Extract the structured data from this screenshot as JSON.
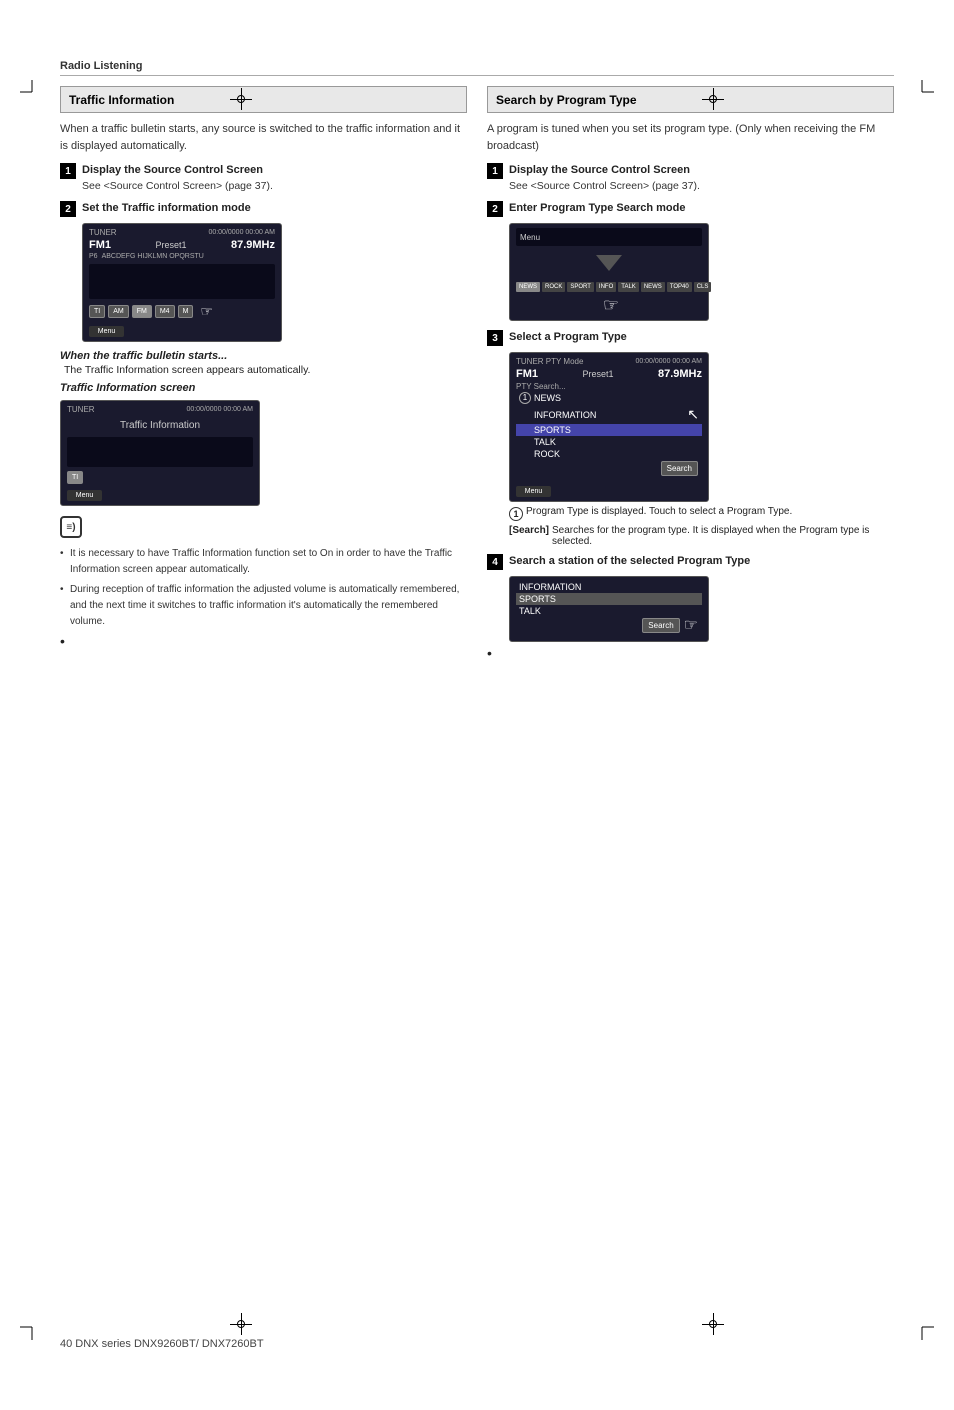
{
  "page": {
    "section_label": "Radio Listening",
    "footer_text": "40   DNX series  DNX9260BT/ DNX7260BT"
  },
  "left_section": {
    "title": "Traffic Information",
    "intro": "When a traffic bulletin starts, any source is switched to the traffic information and it is displayed automatically.",
    "step1": {
      "num": "1",
      "title": "Display the Source Control Screen",
      "sub": "See <Source Control Screen> (page 37)."
    },
    "step2": {
      "num": "2",
      "title": "Set the Traffic information mode"
    },
    "tuner1": {
      "label": "TUNER",
      "time": "00:00/0000 00:00 AM",
      "fm": "FM1",
      "preset": "Preset1",
      "freq": "87.9MHz",
      "p6": "P6",
      "text": "ABCDEFG HIJKLMN OPQRSTU",
      "menu": "Menu"
    },
    "when_bulletin": {
      "title": "When the traffic bulletin starts...",
      "text": "The Traffic Information screen appears automatically."
    },
    "traffic_info_screen": {
      "title": "Traffic Information screen",
      "label": "TUNER",
      "time": "00:00/0000 00:00 AM",
      "content": "Traffic Information",
      "menu": "Menu"
    },
    "notes": [
      "It is necessary to have Traffic Information function set to On in order to have the Traffic Information screen appear automatically.",
      "During reception of traffic information the adjusted volume is automatically remembered, and the next time it switches to traffic information it's automatically the remembered volume."
    ]
  },
  "right_section": {
    "title": "Search by Program Type",
    "intro": "A program is tuned when you set its program type. (Only when receiving the FM broadcast)",
    "step1": {
      "num": "1",
      "title": "Display the Source Control Screen",
      "sub": "See <Source Control Screen> (page 37)."
    },
    "step2": {
      "num": "2",
      "title": "Enter Program Type Search mode"
    },
    "step3": {
      "num": "3",
      "title": "Select a Program Type",
      "pty_screen": {
        "label": "TUNER PTY Mode",
        "fm": "FM1",
        "preset": "Preset1",
        "freq": "87.9MHz",
        "time": "00:00/0000 00:00 AM",
        "pty_search": "PTY Search...",
        "items": [
          "NEWS",
          "INFORMATION",
          "SPORTS",
          "TALK",
          "ROCK"
        ],
        "selected": "SPORTS"
      },
      "note1": "Program Type is displayed. Touch to select a Program Type.",
      "note_search": "[Search]",
      "note_search_text": "Searches for the program type. It is displayed when the Program type is selected."
    },
    "step4": {
      "num": "4",
      "title": "Search a station of the selected Program Type",
      "search_items": [
        "INFORMATION",
        "SPORTS",
        "TALK"
      ],
      "selected": "SPORTS"
    }
  }
}
